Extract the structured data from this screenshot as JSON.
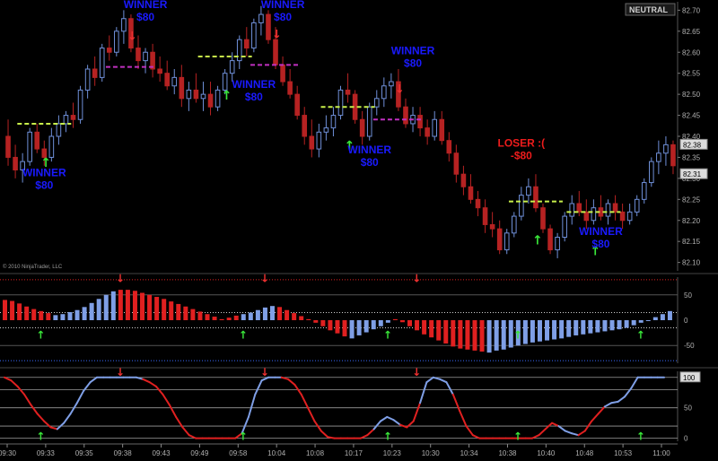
{
  "chart_data": [
    {
      "type": "candlestick",
      "panel": "price",
      "ylim": [
        82.08,
        82.72
      ],
      "yticks": [
        "82.70",
        "82.65",
        "82.60",
        "82.55",
        "82.50",
        "82.45",
        "82.40",
        "82.35",
        "82.30",
        "82.25",
        "82.20",
        "82.15",
        "82.10"
      ],
      "price_labels": [
        {
          "text": "82.38",
          "value": 82.38
        },
        {
          "text": "82.31",
          "value": 82.31
        }
      ],
      "copyright": "© 2010 NinjaTrader, LLC",
      "badge": "NEUTRAL",
      "bars": [
        {
          "o": 82.4,
          "h": 82.44,
          "l": 82.33,
          "c": 82.35
        },
        {
          "o": 82.35,
          "h": 82.38,
          "l": 82.3,
          "c": 82.32
        },
        {
          "o": 82.32,
          "h": 82.36,
          "l": 82.29,
          "c": 82.34
        },
        {
          "o": 82.34,
          "h": 82.42,
          "l": 82.33,
          "c": 82.41
        },
        {
          "o": 82.41,
          "h": 82.43,
          "l": 82.36,
          "c": 82.37
        },
        {
          "o": 82.37,
          "h": 82.39,
          "l": 82.33,
          "c": 82.35
        },
        {
          "o": 82.35,
          "h": 82.42,
          "l": 82.34,
          "c": 82.4
        },
        {
          "o": 82.4,
          "h": 82.45,
          "l": 82.38,
          "c": 82.43
        },
        {
          "o": 82.43,
          "h": 82.46,
          "l": 82.41,
          "c": 82.45
        },
        {
          "o": 82.45,
          "h": 82.48,
          "l": 82.42,
          "c": 82.44
        },
        {
          "o": 82.44,
          "h": 82.52,
          "l": 82.43,
          "c": 82.51
        },
        {
          "o": 82.51,
          "h": 82.57,
          "l": 82.49,
          "c": 82.56
        },
        {
          "o": 82.56,
          "h": 82.59,
          "l": 82.52,
          "c": 82.54
        },
        {
          "o": 82.54,
          "h": 82.62,
          "l": 82.53,
          "c": 82.61
        },
        {
          "o": 82.61,
          "h": 82.64,
          "l": 82.58,
          "c": 82.6
        },
        {
          "o": 82.6,
          "h": 82.66,
          "l": 82.59,
          "c": 82.65
        },
        {
          "o": 82.65,
          "h": 82.7,
          "l": 82.62,
          "c": 82.68
        },
        {
          "o": 82.68,
          "h": 82.69,
          "l": 82.6,
          "c": 82.61
        },
        {
          "o": 82.61,
          "h": 82.64,
          "l": 82.56,
          "c": 82.58
        },
        {
          "o": 82.58,
          "h": 82.61,
          "l": 82.55,
          "c": 82.6
        },
        {
          "o": 82.6,
          "h": 82.62,
          "l": 82.54,
          "c": 82.56
        },
        {
          "o": 82.56,
          "h": 82.59,
          "l": 82.53,
          "c": 82.55
        },
        {
          "o": 82.55,
          "h": 82.58,
          "l": 82.51,
          "c": 82.52
        },
        {
          "o": 82.52,
          "h": 82.56,
          "l": 82.5,
          "c": 82.54
        },
        {
          "o": 82.54,
          "h": 82.57,
          "l": 82.47,
          "c": 82.49
        },
        {
          "o": 82.49,
          "h": 82.53,
          "l": 82.46,
          "c": 82.51
        },
        {
          "o": 82.51,
          "h": 82.55,
          "l": 82.48,
          "c": 82.49
        },
        {
          "o": 82.49,
          "h": 82.53,
          "l": 82.46,
          "c": 82.5
        },
        {
          "o": 82.5,
          "h": 82.53,
          "l": 82.45,
          "c": 82.47
        },
        {
          "o": 82.47,
          "h": 82.52,
          "l": 82.46,
          "c": 82.51
        },
        {
          "o": 82.51,
          "h": 82.56,
          "l": 82.5,
          "c": 82.55
        },
        {
          "o": 82.55,
          "h": 82.6,
          "l": 82.53,
          "c": 82.58
        },
        {
          "o": 82.58,
          "h": 82.64,
          "l": 82.56,
          "c": 82.63
        },
        {
          "o": 82.63,
          "h": 82.66,
          "l": 82.59,
          "c": 82.61
        },
        {
          "o": 82.61,
          "h": 82.68,
          "l": 82.6,
          "c": 82.67
        },
        {
          "o": 82.67,
          "h": 82.71,
          "l": 82.64,
          "c": 82.69
        },
        {
          "o": 82.69,
          "h": 82.7,
          "l": 82.62,
          "c": 82.63
        },
        {
          "o": 82.63,
          "h": 82.66,
          "l": 82.56,
          "c": 82.57
        },
        {
          "o": 82.57,
          "h": 82.59,
          "l": 82.52,
          "c": 82.53
        },
        {
          "o": 82.53,
          "h": 82.56,
          "l": 82.49,
          "c": 82.5
        },
        {
          "o": 82.5,
          "h": 82.52,
          "l": 82.44,
          "c": 82.45
        },
        {
          "o": 82.45,
          "h": 82.47,
          "l": 82.38,
          "c": 82.4
        },
        {
          "o": 82.4,
          "h": 82.44,
          "l": 82.35,
          "c": 82.37
        },
        {
          "o": 82.37,
          "h": 82.43,
          "l": 82.35,
          "c": 82.41
        },
        {
          "o": 82.41,
          "h": 82.45,
          "l": 82.39,
          "c": 82.42
        },
        {
          "o": 82.42,
          "h": 82.47,
          "l": 82.4,
          "c": 82.45
        },
        {
          "o": 82.45,
          "h": 82.52,
          "l": 82.44,
          "c": 82.51
        },
        {
          "o": 82.51,
          "h": 82.55,
          "l": 82.48,
          "c": 82.5
        },
        {
          "o": 82.5,
          "h": 82.51,
          "l": 82.43,
          "c": 82.44
        },
        {
          "o": 82.44,
          "h": 82.46,
          "l": 82.38,
          "c": 82.4
        },
        {
          "o": 82.4,
          "h": 82.48,
          "l": 82.39,
          "c": 82.47
        },
        {
          "o": 82.47,
          "h": 82.51,
          "l": 82.45,
          "c": 82.49
        },
        {
          "o": 82.49,
          "h": 82.54,
          "l": 82.47,
          "c": 82.52
        },
        {
          "o": 82.52,
          "h": 82.55,
          "l": 82.49,
          "c": 82.53
        },
        {
          "o": 82.53,
          "h": 82.56,
          "l": 82.46,
          "c": 82.47
        },
        {
          "o": 82.47,
          "h": 82.49,
          "l": 82.42,
          "c": 82.43
        },
        {
          "o": 82.43,
          "h": 82.47,
          "l": 82.41,
          "c": 82.45
        },
        {
          "o": 82.45,
          "h": 82.47,
          "l": 82.4,
          "c": 82.42
        },
        {
          "o": 82.42,
          "h": 82.44,
          "l": 82.38,
          "c": 82.4
        },
        {
          "o": 82.4,
          "h": 82.46,
          "l": 82.39,
          "c": 82.44
        },
        {
          "o": 82.44,
          "h": 82.46,
          "l": 82.38,
          "c": 82.39
        },
        {
          "o": 82.39,
          "h": 82.41,
          "l": 82.34,
          "c": 82.36
        },
        {
          "o": 82.36,
          "h": 82.38,
          "l": 82.29,
          "c": 82.31
        },
        {
          "o": 82.31,
          "h": 82.33,
          "l": 82.26,
          "c": 82.28
        },
        {
          "o": 82.28,
          "h": 82.31,
          "l": 82.24,
          "c": 82.25
        },
        {
          "o": 82.25,
          "h": 82.27,
          "l": 82.21,
          "c": 82.23
        },
        {
          "o": 82.23,
          "h": 82.25,
          "l": 82.17,
          "c": 82.19
        },
        {
          "o": 82.19,
          "h": 82.22,
          "l": 82.16,
          "c": 82.18
        },
        {
          "o": 82.18,
          "h": 82.2,
          "l": 82.12,
          "c": 82.13
        },
        {
          "o": 82.13,
          "h": 82.18,
          "l": 82.12,
          "c": 82.17
        },
        {
          "o": 82.17,
          "h": 82.22,
          "l": 82.16,
          "c": 82.21
        },
        {
          "o": 82.21,
          "h": 82.28,
          "l": 82.2,
          "c": 82.26
        },
        {
          "o": 82.26,
          "h": 82.3,
          "l": 82.24,
          "c": 82.28
        },
        {
          "o": 82.28,
          "h": 82.31,
          "l": 82.22,
          "c": 82.23
        },
        {
          "o": 82.23,
          "h": 82.24,
          "l": 82.17,
          "c": 82.18
        },
        {
          "o": 82.18,
          "h": 82.19,
          "l": 82.12,
          "c": 82.13
        },
        {
          "o": 82.13,
          "h": 82.17,
          "l": 82.11,
          "c": 82.16
        },
        {
          "o": 82.16,
          "h": 82.22,
          "l": 82.15,
          "c": 82.21
        },
        {
          "o": 82.21,
          "h": 82.26,
          "l": 82.19,
          "c": 82.24
        },
        {
          "o": 82.24,
          "h": 82.27,
          "l": 82.21,
          "c": 82.22
        },
        {
          "o": 82.22,
          "h": 82.25,
          "l": 82.18,
          "c": 82.2
        },
        {
          "o": 82.2,
          "h": 82.25,
          "l": 82.19,
          "c": 82.23
        },
        {
          "o": 82.23,
          "h": 82.26,
          "l": 82.2,
          "c": 82.21
        },
        {
          "o": 82.21,
          "h": 82.25,
          "l": 82.19,
          "c": 82.24
        },
        {
          "o": 82.24,
          "h": 82.26,
          "l": 82.2,
          "c": 82.22
        },
        {
          "o": 82.22,
          "h": 82.24,
          "l": 82.18,
          "c": 82.2
        },
        {
          "o": 82.2,
          "h": 82.24,
          "l": 82.19,
          "c": 82.22
        },
        {
          "o": 82.22,
          "h": 82.26,
          "l": 82.21,
          "c": 82.25
        },
        {
          "o": 82.25,
          "h": 82.3,
          "l": 82.24,
          "c": 82.29
        },
        {
          "o": 82.29,
          "h": 82.35,
          "l": 82.28,
          "c": 82.34
        },
        {
          "o": 82.34,
          "h": 82.39,
          "l": 82.31,
          "c": 82.36
        },
        {
          "o": 82.36,
          "h": 82.4,
          "l": 82.33,
          "c": 82.38
        },
        {
          "o": 82.38,
          "h": 82.39,
          "l": 82.31,
          "c": 82.33
        }
      ],
      "entries": [
        {
          "bar": 5,
          "level": 82.43,
          "side": "long"
        },
        {
          "bar": 30,
          "level": 82.59,
          "side": "long"
        },
        {
          "bar": 47,
          "level": 82.47,
          "side": "long"
        },
        {
          "bar": 73,
          "level": 82.245,
          "side": "long"
        },
        {
          "bar": 81,
          "level": 82.22,
          "side": "long"
        }
      ],
      "exits": [
        {
          "bar": 17,
          "level": 82.565,
          "side": "short"
        },
        {
          "bar": 37,
          "level": 82.57,
          "side": "short"
        },
        {
          "bar": 54,
          "level": 82.44,
          "side": "short"
        }
      ],
      "labels": [
        {
          "l1": "WINNER",
          "l2": "$80",
          "bar": 5,
          "price": 82.305,
          "color": "#1a1aff"
        },
        {
          "l1": "WINNER",
          "l2": "$80",
          "bar": 19,
          "price": 82.705,
          "color": "#1a1aff"
        },
        {
          "l1": "WINNER",
          "l2": "$80",
          "bar": 38,
          "price": 82.705,
          "color": "#1a1aff"
        },
        {
          "l1": "WINNER",
          "l2": "$80",
          "bar": 34,
          "price": 82.515,
          "color": "#1a1aff"
        },
        {
          "l1": "WINNER",
          "l2": "$80",
          "bar": 56,
          "price": 82.595,
          "color": "#1a1aff"
        },
        {
          "l1": "WINNER",
          "l2": "$80",
          "bar": 50,
          "price": 82.36,
          "color": "#1a1aff"
        },
        {
          "l1": "LOSER :(",
          "l2": "-$80",
          "bar": 71,
          "price": 82.375,
          "color": "#ee1c1c"
        },
        {
          "l1": "WINNER",
          "l2": "$80",
          "bar": 82,
          "price": 82.165,
          "color": "#1a1aff"
        }
      ]
    },
    {
      "type": "histogram",
      "panel": "oscillator",
      "ylim": [
        -85,
        85
      ],
      "yticks": [
        "50",
        "0",
        "-50"
      ],
      "bands": [
        80,
        15,
        -15,
        -80
      ],
      "values": [
        40,
        38,
        33,
        27,
        22,
        18,
        14,
        10,
        12,
        16,
        20,
        26,
        34,
        42,
        50,
        57,
        60,
        60,
        58,
        54,
        50,
        46,
        42,
        37,
        32,
        27,
        22,
        17,
        12,
        7,
        2,
        5,
        9,
        12,
        15,
        20,
        25,
        28,
        26,
        20,
        14,
        8,
        2,
        -5,
        -12,
        -20,
        -26,
        -32,
        -36,
        -30,
        -24,
        -18,
        -12,
        -5,
        2,
        -4,
        -12,
        -20,
        -28,
        -34,
        -40,
        -46,
        -52,
        -56,
        -58,
        -60,
        -62,
        -64,
        -60,
        -58,
        -54,
        -50,
        -47,
        -44,
        -42,
        -40,
        -38,
        -36,
        -33,
        -30,
        -28,
        -26,
        -24,
        -22,
        -20,
        -18,
        -15,
        -10,
        -5,
        0,
        6,
        12,
        18
      ],
      "colors": "rrrrrrrbbbbbbbbbrrrrrrrrrrrrrrrrrbbbbbrrrrrrrrrrbbbbbbrrrrrrrrrrrrrbbbbbbbbbbbbbbbbbbbbbbbbbbbbbbb"
    },
    {
      "type": "line",
      "panel": "stochastic",
      "ylim": [
        -5,
        110
      ],
      "yticks": [
        "100",
        "50",
        "0"
      ],
      "badge": "100",
      "guides": [
        100,
        80,
        50,
        20,
        0
      ],
      "values": [
        100,
        95,
        85,
        72,
        55,
        40,
        28,
        18,
        15,
        25,
        40,
        58,
        78,
        92,
        100,
        100,
        100,
        100,
        100,
        100,
        100,
        97,
        92,
        85,
        72,
        55,
        35,
        18,
        5,
        0,
        0,
        0,
        0,
        0,
        0,
        0,
        8,
        35,
        72,
        95,
        100,
        100,
        100,
        97,
        88,
        72,
        50,
        28,
        12,
        2,
        0,
        0,
        0,
        0,
        0,
        5,
        15,
        28,
        35,
        30,
        22,
        18,
        28,
        58,
        92,
        100,
        97,
        92,
        72,
        45,
        20,
        5,
        0,
        0,
        0,
        0,
        0,
        0,
        0,
        0,
        0,
        5,
        15,
        25,
        20,
        12,
        8,
        5,
        12,
        28,
        40,
        52,
        58,
        60,
        68,
        82,
        100,
        100,
        100,
        100,
        100
      ],
      "colors": "rrrrrrrrbbbbbbbbbbbbbrrrrrrrrrrrrrrrbbbbbbrrrrrrrrrrrrrrbbbbrrrbbbbbrrrrrrrrrrrrrrrrbbbrrrrbbbbbbbbbbbbbbbb",
      "xticks": [
        "09:30",
        "09:33",
        "09:35",
        "09:38",
        "09:43",
        "09:49",
        "09:58",
        "10:04",
        "10:08",
        "10:17",
        "10:23",
        "10:30",
        "10:34",
        "10:38",
        "10:40",
        "10:48",
        "10:53",
        "11:00"
      ]
    }
  ]
}
